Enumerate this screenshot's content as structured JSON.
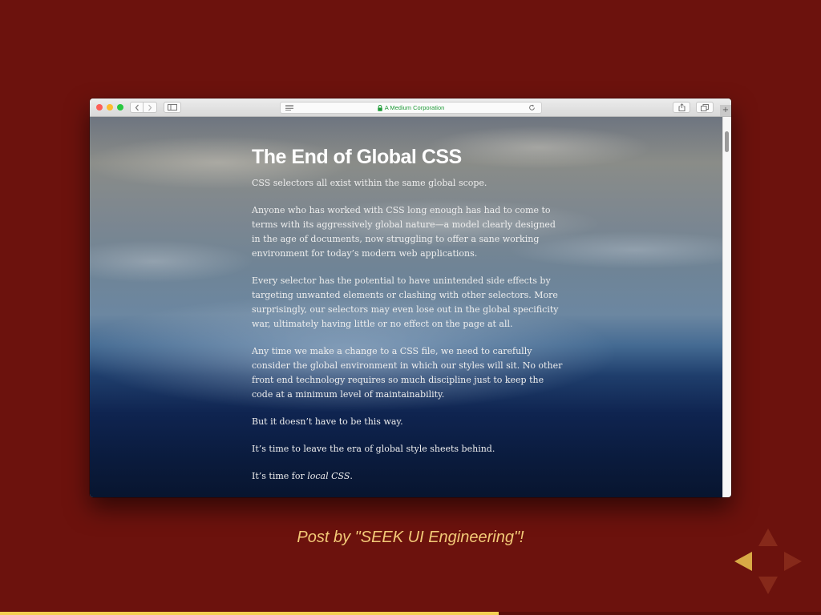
{
  "browser": {
    "address_text": "A Medium Corporation",
    "icons": {
      "back": "chevron-left-icon",
      "forward": "chevron-right-icon",
      "sidebar": "sidebar-icon",
      "reader": "reader-icon",
      "lock": "lock-icon",
      "reload": "reload-icon",
      "share": "share-icon",
      "tabs": "tabs-icon"
    },
    "new_tab_label": "+"
  },
  "article": {
    "title": "The End of Global CSS",
    "paragraphs": [
      "CSS selectors all exist within the same global scope.",
      "Anyone who has worked with CSS long enough has had to come to terms with its aggressively global nature—a model clearly designed in the age of documents, now struggling to offer a sane working environment for today’s modern web applications.",
      "Every selector has the potential to have unintended side effects by targeting unwanted elements or clashing with other selectors. More surprisingly, our selectors may even lose out in the global specificity war, ultimately having little or no effect on the page at all.",
      "Any time we make a change to a CSS file, we need to carefully consider the global environment in which our styles will sit. No other front end technology requires so much discipline just to keep the code at a minimum level of maintainability.",
      "But it doesn’t have to be this way.",
      "It’s time to leave the era of global style sheets behind."
    ],
    "last_paragraph": {
      "prefix": "It’s time for ",
      "emphasis": "local CSS",
      "suffix": "."
    }
  },
  "slide": {
    "caption": "Post by \"SEEK UI Engineering\"!",
    "progress_fraction": 0.607,
    "colors": {
      "background": "#6c120d",
      "caption": "#f2c977",
      "progress": "#f4cf52",
      "nav_active": "#d8aa45",
      "nav_inactive": "#86291a"
    }
  }
}
